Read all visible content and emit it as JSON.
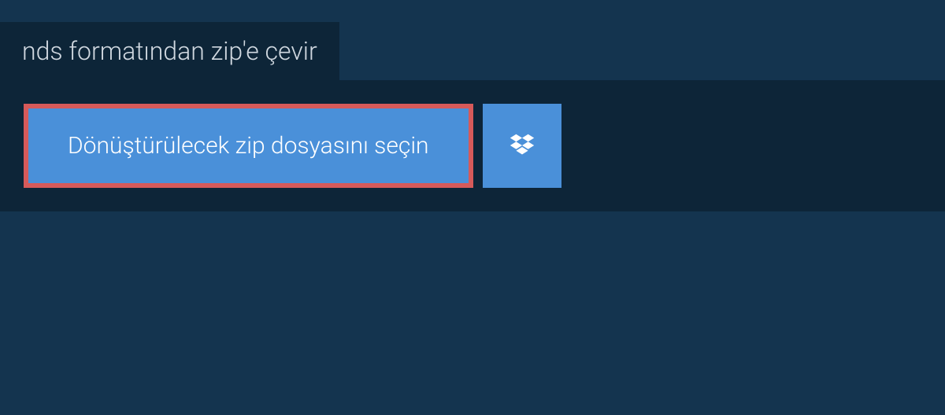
{
  "tab": {
    "label": "nds formatından zip'e çevir"
  },
  "actions": {
    "select_file_label": "Dönüştürülecek zip dosyasını seçin"
  },
  "icons": {
    "dropbox": "dropbox-icon"
  },
  "colors": {
    "background": "#14344f",
    "panel": "#0d2538",
    "button": "#4a90d9",
    "highlight_border": "#d65a5a",
    "text_light": "#ffffff",
    "text_muted": "#d0d8e0"
  }
}
